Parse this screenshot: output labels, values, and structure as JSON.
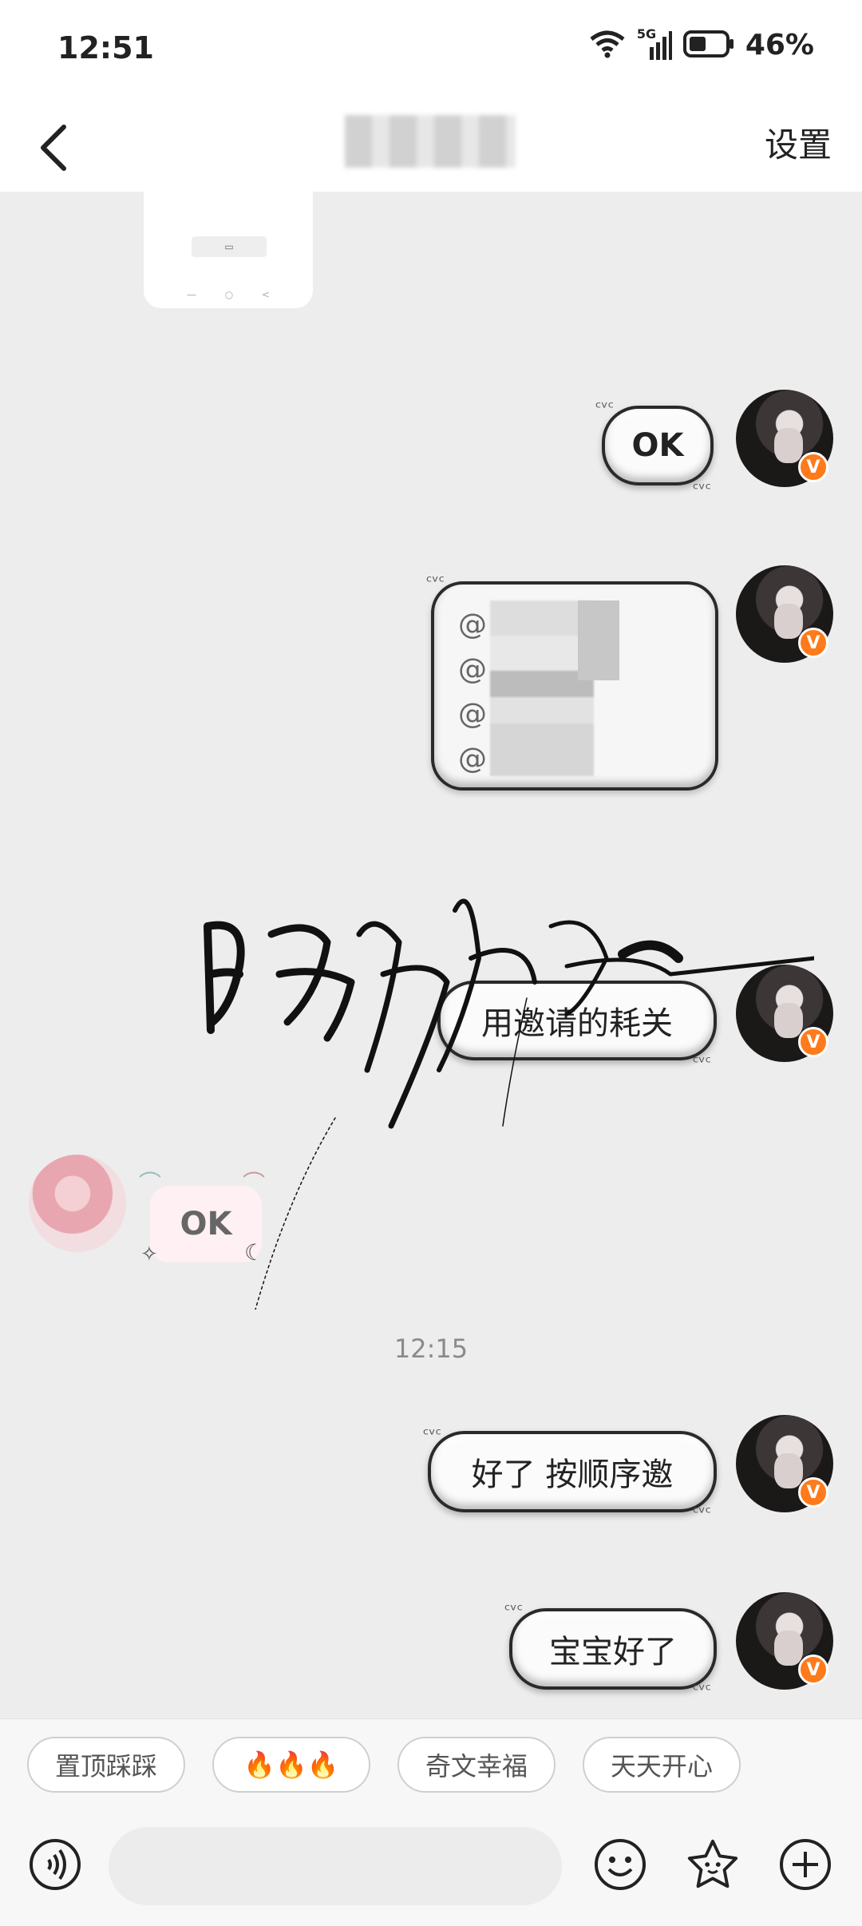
{
  "status_bar": {
    "time": "12:51",
    "network": "5G",
    "battery": "46%"
  },
  "header": {
    "settings_label": "设置"
  },
  "messages": [
    {
      "text": "OK"
    },
    {
      "mentions": [
        "@",
        "@",
        "@",
        "@",
        "@",
        "@"
      ]
    },
    {
      "text": "用邀请的耗关"
    },
    {
      "text": "OK"
    },
    {
      "text": "好了 按顺序邀"
    },
    {
      "text": "宝宝好了"
    }
  ],
  "timestamp": "12:15",
  "avatar_badge": "V",
  "quick_replies": [
    "置顶踩踩",
    "🔥🔥🔥",
    "奇文幸福",
    "天天开心"
  ],
  "icons": [
    "back-chevron-icon",
    "wifi-icon",
    "signal-icon",
    "battery-icon",
    "voice-icon",
    "emoji-icon",
    "sticker-icon",
    "plus-icon"
  ]
}
